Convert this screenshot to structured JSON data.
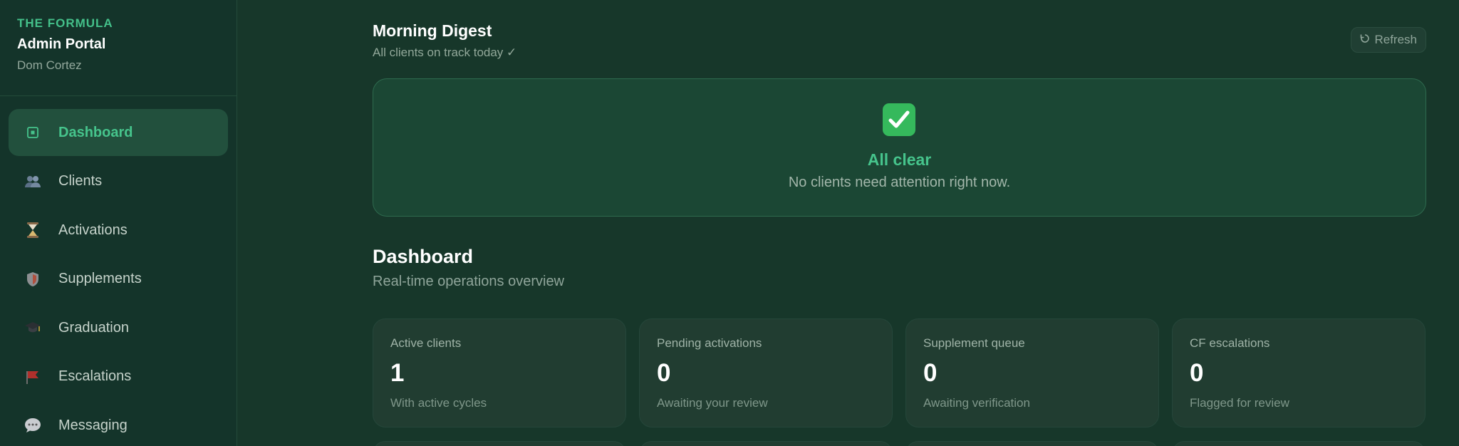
{
  "brand": {
    "kicker": "THE FORMULA",
    "title": "Admin Portal",
    "user": "Dom Cortez"
  },
  "sidebar": {
    "items": [
      {
        "label": "Dashboard",
        "icon": "dashboard-icon",
        "active": true
      },
      {
        "label": "Clients",
        "icon": "users-icon",
        "active": false
      },
      {
        "label": "Activations",
        "icon": "hourglass-icon",
        "active": false
      },
      {
        "label": "Supplements",
        "icon": "shield-icon",
        "active": false
      },
      {
        "label": "Graduation",
        "icon": "graduation-cap-icon",
        "active": false
      },
      {
        "label": "Escalations",
        "icon": "flag-icon",
        "active": false
      },
      {
        "label": "Messaging",
        "icon": "speech-bubble-icon",
        "active": false
      }
    ]
  },
  "digest": {
    "title": "Morning Digest",
    "subtitle": "All clients on track today ✓",
    "refresh_label": "Refresh",
    "status_heading": "All clear",
    "status_text": "No clients need attention right now."
  },
  "dashboard": {
    "title": "Dashboard",
    "subtitle": "Real-time operations overview",
    "stats": [
      {
        "label": "Active clients",
        "value": "1",
        "note": "With active cycles"
      },
      {
        "label": "Pending activations",
        "value": "0",
        "note": "Awaiting your review"
      },
      {
        "label": "Supplement queue",
        "value": "0",
        "note": "Awaiting verification"
      },
      {
        "label": "CF escalations",
        "value": "0",
        "note": "Flagged for review"
      }
    ]
  },
  "colors": {
    "accent": "#46c48c",
    "background": "#17372a",
    "sidebar": "#14342a",
    "active_nav": "#22503d"
  }
}
